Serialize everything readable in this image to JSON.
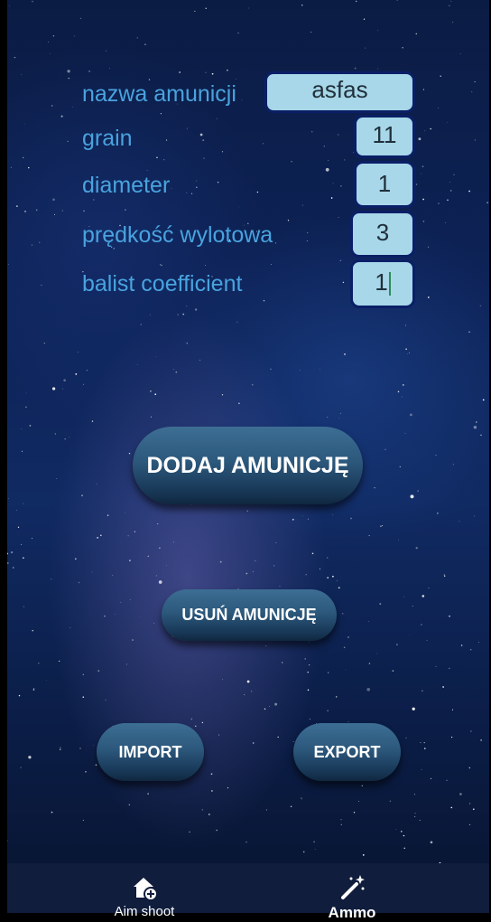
{
  "form": {
    "name_label": "nazwa amunicji",
    "name_value": "asfas",
    "grain_label": "grain",
    "grain_value": "11",
    "diameter_label": "diameter",
    "diameter_value": "1",
    "velocity_label": "prędkość wylotowa",
    "velocity_value": "3",
    "ballistic_label": "balist coefficient",
    "ballistic_value": "1"
  },
  "buttons": {
    "add_label": "DODAJ AMUNICJĘ",
    "remove_label": "USUŃ AMUNICJĘ",
    "import_label": "IMPORT",
    "export_label": "EXPORT"
  },
  "bottom_nav": {
    "items": [
      {
        "label": "Aim shoot",
        "icon": "home-add-icon"
      },
      {
        "label": "Ammo",
        "icon": "magic-wand-icon",
        "active": true
      }
    ]
  },
  "colors": {
    "label_text": "#49a3de",
    "field_bg": "#a7d7e9",
    "field_border": "#0a1f66",
    "button_top": "#3d6e94",
    "button_bottom": "#10273f",
    "nav_bg": "#101d3c"
  }
}
